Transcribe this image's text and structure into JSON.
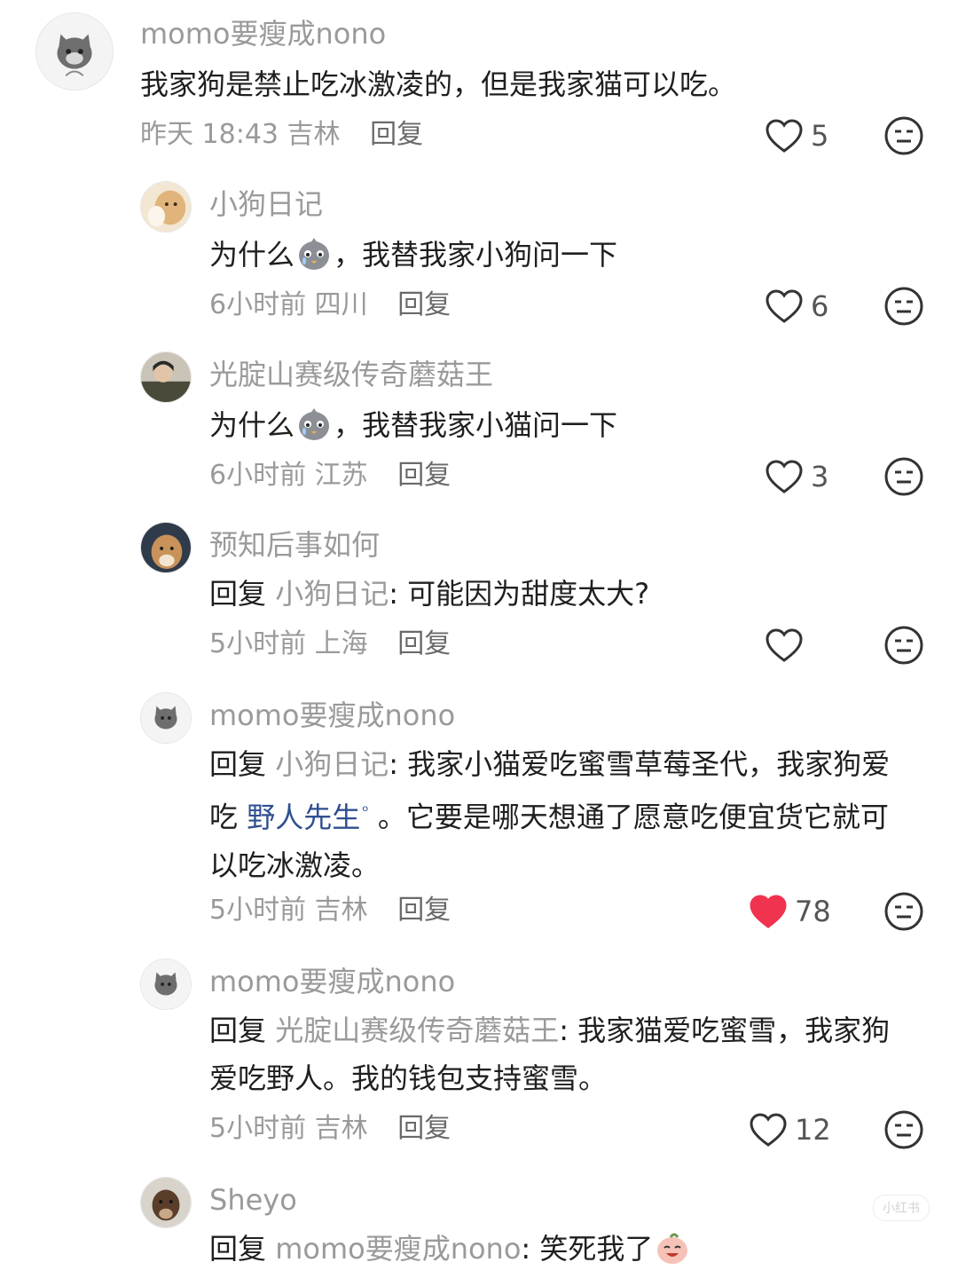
{
  "accent": {
    "like_active": "#f0334f",
    "link": "#2f4f8f",
    "muted": "#9a9a9a"
  },
  "comments": [
    {
      "username": "momo要瘦成nono",
      "text": "我家狗是禁止吃冰激凌的，但是我家猫可以吃。",
      "time": "昨天 18:43",
      "location": "吉林",
      "reply_label": "回复",
      "likes": "5",
      "avatar_icon": "cat-avatar-icon"
    },
    {
      "username": "小狗日记",
      "text_before": "为什么",
      "emoji": "crying-chick-emoji",
      "text_after": "，我替我家小狗问一下",
      "time": "6小时前",
      "location": "四川",
      "reply_label": "回复",
      "likes": "6",
      "avatar_icon": "dog-avatar-icon"
    },
    {
      "username": "光腚山赛级传奇蘑菇王",
      "text_before": "为什么",
      "emoji": "crying-chick-emoji",
      "text_after": "，我替我家小猫问一下",
      "time": "6小时前",
      "location": "江苏",
      "reply_label": "回复",
      "likes": "3",
      "avatar_icon": "person-avatar-icon"
    },
    {
      "username": "预知后事如何",
      "reply_prefix": "回复",
      "reply_to": "小狗日记",
      "text": ": 可能因为甜度太大?",
      "time": "5小时前",
      "location": "上海",
      "reply_label": "回复",
      "likes": "",
      "avatar_icon": "dog-avatar-icon"
    },
    {
      "username": "momo要瘦成nono",
      "reply_prefix": "回复",
      "reply_to": "小狗日记",
      "text_a": ": 我家小猫爱吃蜜雪草莓圣代，我家狗爱吃 ",
      "link": "野人先生",
      "text_b": " 。它要是哪天想通了愿意吃便宜货它就可以吃冰激凌。",
      "time": "5小时前",
      "location": "吉林",
      "reply_label": "回复",
      "likes": "78",
      "avatar_icon": "cat-avatar-icon"
    },
    {
      "username": "momo要瘦成nono",
      "reply_prefix": "回复",
      "reply_to": "光腚山赛级传奇蘑菇王",
      "text": ": 我家猫爱吃蜜雪，我家狗爱吃野人。我的钱包支持蜜雪。",
      "time": "5小时前",
      "location": "吉林",
      "reply_label": "回复",
      "likes": "12",
      "avatar_icon": "cat-avatar-icon"
    },
    {
      "username": "Sheyo",
      "reply_prefix": "回复",
      "reply_to": "momo要瘦成nono",
      "text": ": 笑死我了",
      "emoji": "laughing-peach-emoji",
      "avatar_icon": "dog-avatar-icon"
    }
  ],
  "watermark": "小红书"
}
